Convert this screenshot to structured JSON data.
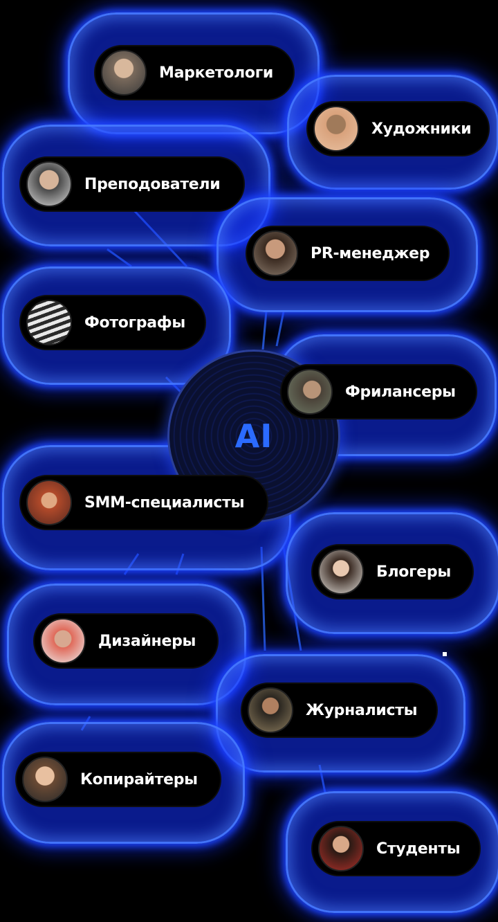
{
  "hub": {
    "label": "AI"
  },
  "colors": {
    "background": "#000000",
    "glow": "#1f3dff",
    "glow_edge": "#4678ff",
    "hub_text": "#2b6bff",
    "pill": "#000000",
    "text": "#ffffff"
  },
  "nodes": [
    {
      "label": "Маркетологи",
      "avatar_icon": "person-photo-avatar",
      "avatar_tone": "#7a6a5c"
    },
    {
      "label": "Художники",
      "avatar_icon": "person-photo-avatar",
      "avatar_tone": "#b88a6a"
    },
    {
      "label": "Преподователи",
      "avatar_icon": "person-photo-avatar",
      "avatar_tone": "#9a8a7c"
    },
    {
      "label": "PR-менеджер",
      "avatar_icon": "person-photo-avatar",
      "avatar_tone": "#8a7a6c"
    },
    {
      "label": "Фотографы",
      "avatar_icon": "person-photo-avatar",
      "avatar_tone": "#6a6a6a"
    },
    {
      "label": "Фрилансеры",
      "avatar_icon": "person-photo-avatar",
      "avatar_tone": "#5e6a5a"
    },
    {
      "label": "SMM-специалисты",
      "avatar_icon": "person-photo-avatar",
      "avatar_tone": "#a8503a"
    },
    {
      "label": "Блогеры",
      "avatar_icon": "person-photo-avatar",
      "avatar_tone": "#c9c2b8"
    },
    {
      "label": "Дизайнеры",
      "avatar_icon": "person-photo-avatar",
      "avatar_tone": "#d8c4b8"
    },
    {
      "label": "Журналисты",
      "avatar_icon": "person-photo-avatar",
      "avatar_tone": "#6c5a48"
    },
    {
      "label": "Копирайтеры",
      "avatar_icon": "person-photo-avatar",
      "avatar_tone": "#b8977c"
    },
    {
      "label": "Студенты",
      "avatar_icon": "person-photo-avatar",
      "avatar_tone": "#9a3a3a"
    }
  ]
}
